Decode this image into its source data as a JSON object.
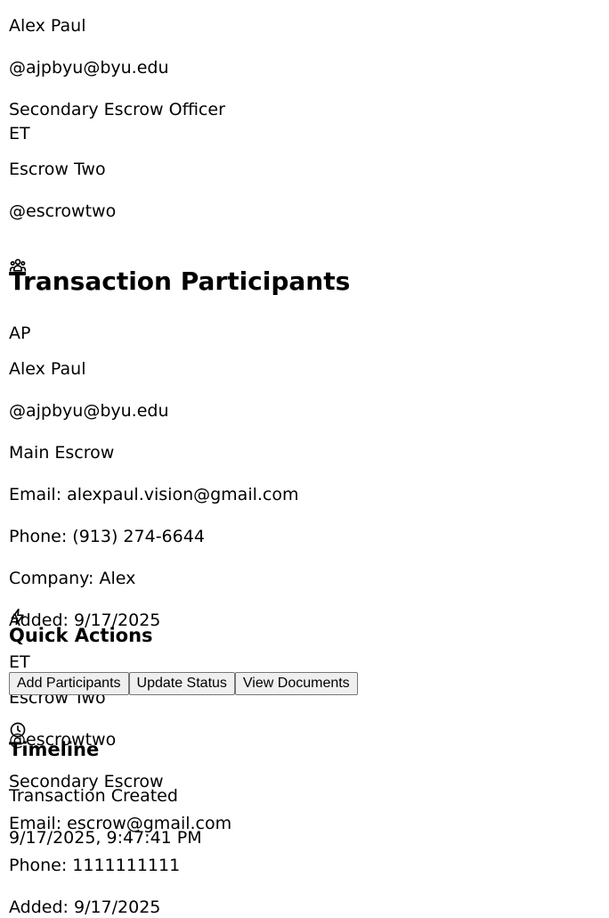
{
  "escrow_officers": [
    {
      "name": "Alex Paul",
      "handle": "@ajpbyu@byu.edu",
      "role": "Secondary Escrow Officer"
    },
    {
      "initials": "ET",
      "name": "Escrow Two",
      "handle": "@escrowtwo"
    }
  ],
  "participants": {
    "title": "Transaction Participants",
    "icon": "users-icon",
    "items": [
      {
        "initials": "AP",
        "name": "Alex Paul",
        "handle": "@ajpbyu@byu.edu",
        "role": "Main Escrow",
        "email": "Email: alexpaul.vision@gmail.com",
        "phone": "Phone: (913) 274-6644",
        "company": "Company: Alex",
        "added": "Added: 9/17/2025"
      },
      {
        "initials": "ET",
        "name": "Escrow Two",
        "handle": "@escrowtwo",
        "role": "Secondary Escrow",
        "email": "Email: escrow@gmail.com",
        "phone": "Phone: 1111111111",
        "added": "Added: 9/17/2025"
      }
    ]
  },
  "quick_actions": {
    "title": "Quick Actions",
    "icon": "lightning-icon",
    "buttons": [
      "Add Participants",
      "Update Status",
      "View Documents"
    ]
  },
  "timeline": {
    "title": "Timeline",
    "icon": "clock-icon",
    "events": [
      {
        "label": "Transaction Created",
        "time": "9/17/2025, 9:47:41 PM"
      }
    ]
  }
}
